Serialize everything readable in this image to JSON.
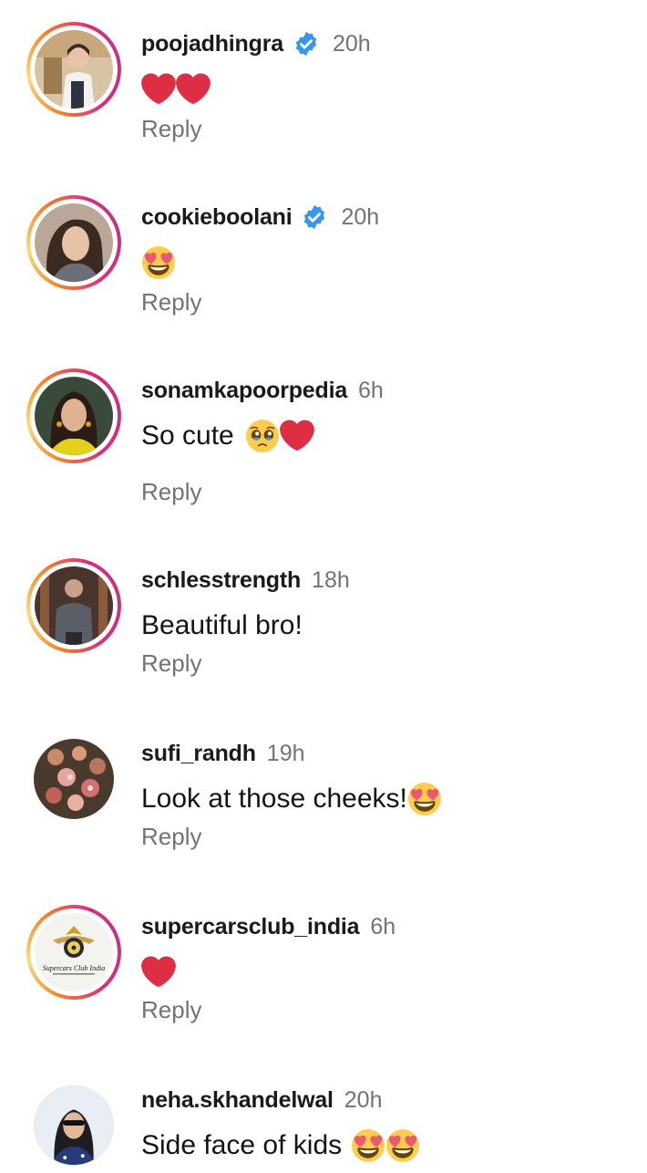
{
  "colors": {
    "text": "#141414",
    "muted": "#737373",
    "verified": "#3797f0",
    "story_ring": [
      "#f58529",
      "#feda77",
      "#dd2a7b",
      "#c13584"
    ]
  },
  "reply_label": "Reply",
  "comments": [
    {
      "username": "poojadhingra",
      "verified": true,
      "time": "20h",
      "text": "",
      "emojis": [
        "red-heart",
        "red-heart"
      ],
      "has_story_ring": true
    },
    {
      "username": "cookieboolani",
      "verified": true,
      "time": "20h",
      "text": "",
      "emojis": [
        "heart-eyes"
      ],
      "has_story_ring": true
    },
    {
      "username": "sonamkapoorpedia",
      "verified": false,
      "time": "6h",
      "text": "So cute",
      "emojis": [
        "pleading-face",
        "red-heart"
      ],
      "has_story_ring": true
    },
    {
      "username": "schlesstrength",
      "verified": false,
      "time": "18h",
      "text": "Beautiful bro!",
      "emojis": [],
      "has_story_ring": true
    },
    {
      "username": "sufi_randh",
      "verified": false,
      "time": "19h",
      "text": "Look at those cheeks!",
      "emojis": [
        "heart-eyes"
      ],
      "has_story_ring": false
    },
    {
      "username": "supercarsclub_india",
      "verified": false,
      "time": "6h",
      "text": "",
      "emojis": [
        "red-heart"
      ],
      "has_story_ring": true,
      "avatar_text": "Supercars Club India"
    },
    {
      "username": "neha.skhandelwal",
      "verified": false,
      "time": "20h",
      "text": "Side face of kids",
      "emojis": [
        "heart-eyes",
        "heart-eyes"
      ],
      "has_story_ring": false
    }
  ]
}
